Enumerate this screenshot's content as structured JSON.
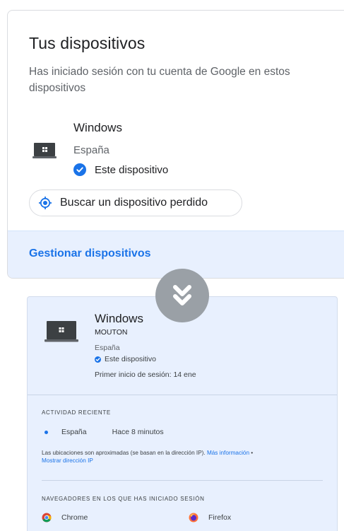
{
  "top_card": {
    "title": "Tus dispositivos",
    "subtitle": "Has iniciado sesión con tu cuenta de Google en estos dispositivos",
    "device": {
      "name": "Windows",
      "location": "España",
      "this_device": "Este dispositivo",
      "icon": "laptop-windows-icon"
    },
    "find_button": "Buscar un dispositivo perdido",
    "manage_link": "Gestionar dispositivos"
  },
  "arrow_icon": "double-chevron-down-icon",
  "detail_card": {
    "device_name": "Windows",
    "host": "MOUTON",
    "location": "España",
    "this_device": "Este dispositivo",
    "first_signin": "Primer inicio de sesión: 14 ene",
    "recent_activity_header": "ACTIVIDAD RECIENTE",
    "activity": {
      "location": "España",
      "time": "Hace 8 minutos"
    },
    "note_text": "Las ubicaciones son aproximadas (se basan en la dirección IP). ",
    "note_link": "Más información",
    "note_sep": " •",
    "show_ip_link": "Mostrar dirección IP",
    "browsers_header": "NAVEGADORES EN LOS QUE HAS INICIADO SESIÓN",
    "browsers": [
      {
        "name": "Chrome",
        "icon": "chrome-icon"
      },
      {
        "name": "Firefox",
        "icon": "firefox-icon"
      }
    ]
  },
  "colors": {
    "accent": "#1a73e8",
    "panel_bg": "#e8f0fe",
    "badge_gray": "#9aa0a6"
  }
}
